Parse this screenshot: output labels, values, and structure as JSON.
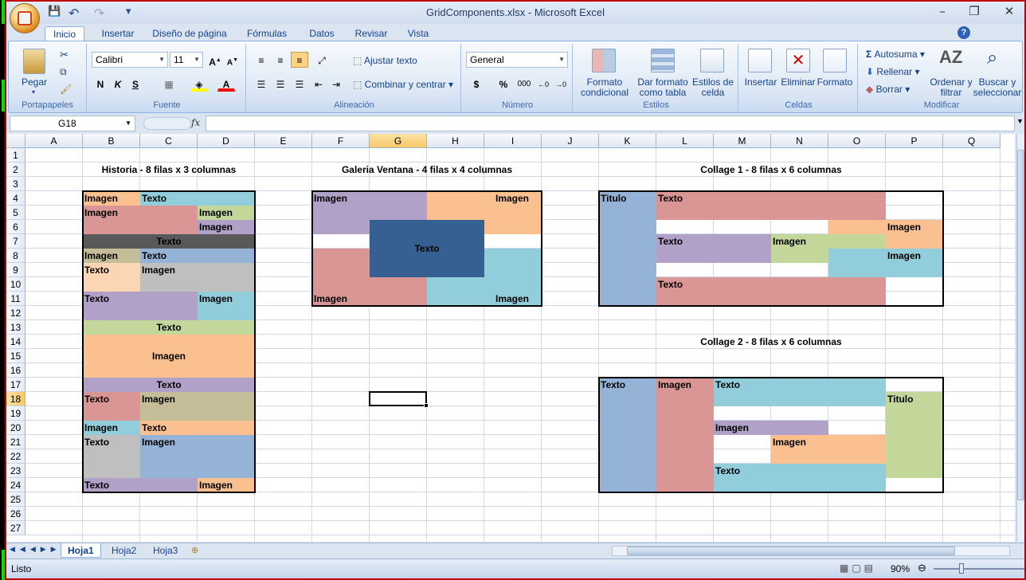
{
  "window": {
    "title": "GridComponents.xlsx - Microsoft Excel",
    "minimize": "–",
    "restore": "❐",
    "close": "✕"
  },
  "qat": {
    "save": "💾",
    "undo": "↶",
    "redo": "↷",
    "customize": "▾"
  },
  "tabs": [
    "Inicio",
    "Insertar",
    "Diseño de página",
    "Fórmulas",
    "Datos",
    "Revisar",
    "Vista"
  ],
  "ribbon": {
    "clipboard": {
      "label": "Portapapeles",
      "paste": "Pegar"
    },
    "font": {
      "label": "Fuente",
      "name": "Calibri",
      "size": "11",
      "bold": "N",
      "italic": "K",
      "underline": "S"
    },
    "alignment": {
      "label": "Alineación",
      "wrap": "Ajustar texto",
      "merge": "Combinar y centrar"
    },
    "number": {
      "label": "Número",
      "format": "General",
      "currency": "$",
      "percent": "%",
      "thousands": "000"
    },
    "styles": {
      "label": "Estilos",
      "conditional": "Formato condicional",
      "table": "Dar formato como tabla",
      "cell": "Estilos de celda"
    },
    "cells": {
      "label": "Celdas",
      "insert": "Insertar",
      "delete": "Eliminar",
      "format": "Formato"
    },
    "editing": {
      "label": "Modificar",
      "autosum": "Autosuma",
      "fill": "Rellenar",
      "clear": "Borrar",
      "sort": "Ordenar y filtrar",
      "find": "Buscar y seleccionar"
    }
  },
  "formula_bar": {
    "name_box": "G18",
    "fx": "fx",
    "value": ""
  },
  "columns": [
    "A",
    "B",
    "C",
    "D",
    "E",
    "F",
    "G",
    "H",
    "I",
    "J",
    "K",
    "L",
    "M",
    "N",
    "O",
    "P",
    "Q"
  ],
  "selected_column": "G",
  "rows": [
    "1",
    "2",
    "3",
    "4",
    "5",
    "6",
    "7",
    "8",
    "9",
    "10",
    "11",
    "12",
    "13",
    "14",
    "15",
    "16",
    "17",
    "18",
    "19",
    "20",
    "21",
    "22",
    "23",
    "24",
    "25",
    "26",
    "27"
  ],
  "selected_row": "18",
  "sections": {
    "historia": "Historia - 8 filas x 3 columnas",
    "galeria": "Galeria Ventana - 4 filas x 4 columnas",
    "collage1": "Collage 1 - 8 filas x 6 columnas",
    "collage2": "Collage 2 - 8 filas x 6 columnas"
  },
  "labels": {
    "imagen": "Imagen",
    "texto": "Texto",
    "titulo": "Titulo"
  },
  "colors": {
    "orange": "#fac090",
    "teal": "#92cddc",
    "rose": "#da9694",
    "green": "#c4d79b",
    "purple": "#b1a0c7",
    "darkgray": "#595959",
    "khaki": "#c4bd97",
    "blue": "#95b3d7",
    "peach": "#fcd5b4",
    "gray": "#bfbfbf",
    "navy": "#366092"
  },
  "sheets": [
    "Hoja1",
    "Hoja2",
    "Hoja3"
  ],
  "active_sheet": "Hoja1",
  "status": {
    "text": "Listo",
    "zoom": "90%"
  }
}
